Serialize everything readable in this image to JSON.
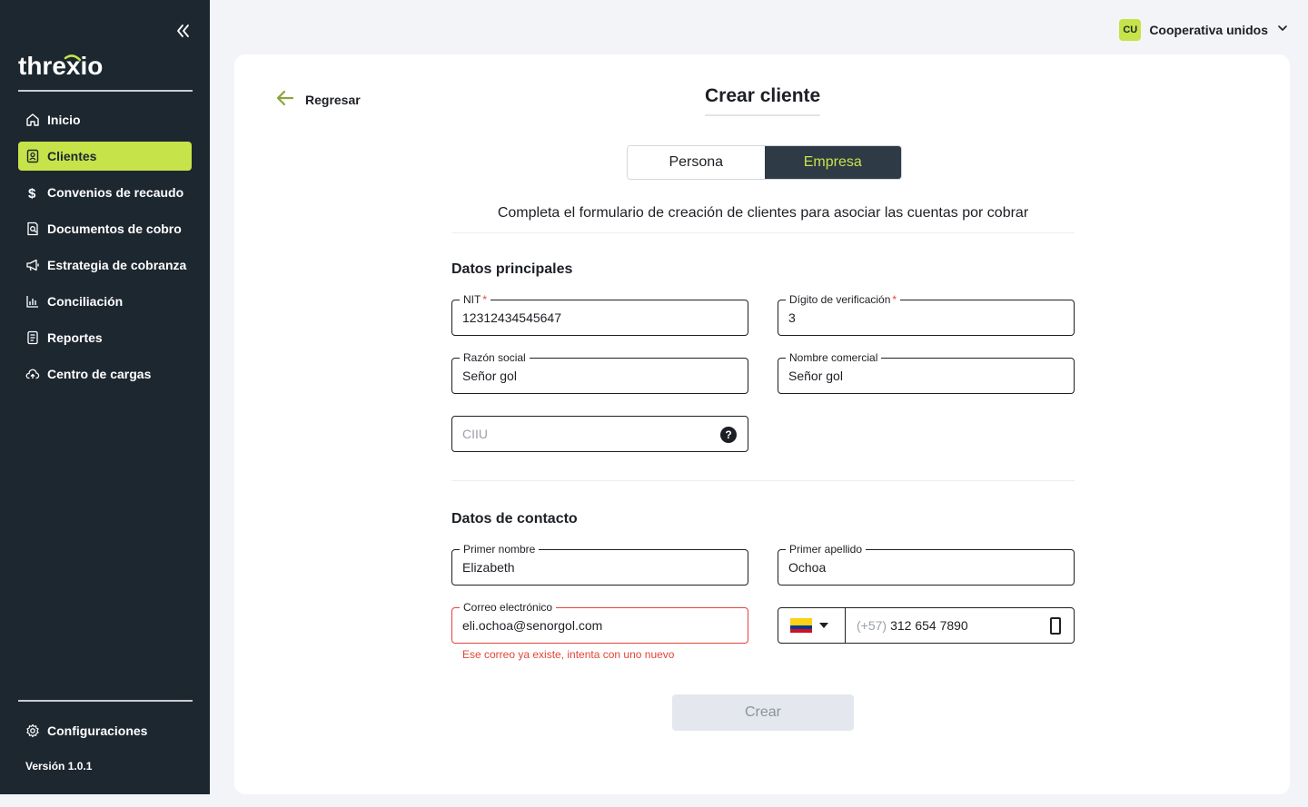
{
  "brand": {
    "logo_text": "threxio",
    "accent": "#c6e34a"
  },
  "sidebar": {
    "items": [
      {
        "label": "Inicio",
        "icon": "home-icon",
        "active": false
      },
      {
        "label": "Clientes",
        "icon": "user-card-icon",
        "active": true
      },
      {
        "label": "Convenios de recaudo",
        "icon": "dollar-icon",
        "active": false
      },
      {
        "label": "Documentos de cobro",
        "icon": "document-search-icon",
        "active": false
      },
      {
        "label": "Estrategia de cobranza",
        "icon": "megaphone-icon",
        "active": false
      },
      {
        "label": "Conciliación",
        "icon": "bar-chart-icon",
        "active": false
      },
      {
        "label": "Reportes",
        "icon": "report-icon",
        "active": false
      },
      {
        "label": "Centro de cargas",
        "icon": "cloud-upload-icon",
        "active": false
      }
    ],
    "config_label": "Configuraciones",
    "version": "Versión 1.0.1"
  },
  "user": {
    "initials": "CU",
    "name": "Cooperativa unidos"
  },
  "page": {
    "back_label": "Regresar",
    "title": "Crear cliente",
    "toggle": {
      "persona": "Persona",
      "empresa": "Empresa",
      "selected": "Empresa"
    },
    "subtitle": "Completa el formulario de creación de clientes para asociar las cuentas por cobrar"
  },
  "main_section": {
    "title": "Datos principales",
    "nit": {
      "label": "NIT",
      "required": "*",
      "value": "12312434545647"
    },
    "dv": {
      "label": "Dígito de verificación",
      "required": "*",
      "value": "3"
    },
    "razon": {
      "label": "Razón social",
      "value": "Señor gol"
    },
    "comercial": {
      "label": "Nombre comercial",
      "value": "Señor gol"
    },
    "ciiu": {
      "placeholder": "CIIU",
      "help": "?"
    }
  },
  "contact_section": {
    "title": "Datos de contacto",
    "first_name": {
      "label": "Primer nombre",
      "value": "Elizabeth"
    },
    "last_name": {
      "label": "Primer apellido",
      "value": "Ochoa"
    },
    "email": {
      "label": "Correo electrónico",
      "value": "eli.ochoa@senorgol.com",
      "error": "Ese correo ya existe, intenta con uno nuevo"
    },
    "phone": {
      "code": "(+57)",
      "number": "312 654 7890",
      "flag": "colombia-flag-icon"
    }
  },
  "submit": {
    "label": "Crear"
  },
  "colors": {
    "sidebar_bg": "#1d2730",
    "error": "#e0453a",
    "segment_active": "#2e3a46"
  }
}
